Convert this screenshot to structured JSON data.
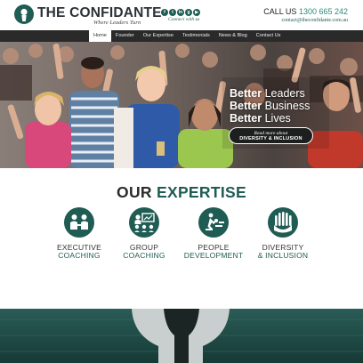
{
  "header": {
    "brand": "THE CONFIDANTE",
    "tagline": "Where Leaders Turn",
    "social_icons": [
      "facebook-icon",
      "twitter-icon",
      "linkedin-icon",
      "google-plus-icon",
      "youtube-icon"
    ],
    "social_caption": "Connect with us",
    "call_label": "CALL US",
    "phone": "1300 665 242",
    "email": "contact@theconfidante.com.au"
  },
  "nav": {
    "items": [
      "Home",
      "Founder",
      "Our Expertise",
      "Testimonials",
      "News & Blog",
      "Contact Us"
    ],
    "active": "Home"
  },
  "hero": {
    "lines": [
      {
        "bold": "Better",
        "rest": "Leaders"
      },
      {
        "bold": "Better",
        "rest": "Business"
      },
      {
        "bold": "Better",
        "rest": "Lives"
      }
    ],
    "button_line1": "Read more about",
    "button_line2": "DIVERSITY & INCLUSION"
  },
  "expertise": {
    "title_part1": "OUR",
    "title_part2": "EXPERTISE",
    "items": [
      {
        "line1": "EXECUTIVE",
        "line2": "COACHING",
        "icon": "executive-coaching-icon"
      },
      {
        "line1": "GROUP",
        "line2": "COACHING",
        "icon": "group-coaching-icon"
      },
      {
        "line1": "PEOPLE",
        "line2": "DEVELOPMENT",
        "icon": "people-development-icon"
      },
      {
        "line1": "DIVERSITY",
        "line2": "& INCLUSION",
        "icon": "diversity-inclusion-icon"
      }
    ]
  },
  "colors": {
    "brand_teal": "#1f5c54",
    "accent_teal": "#2c8a7d",
    "nav_bg": "#2a2a2a",
    "hero_button_bg": "#1d1f1f",
    "band_bg": "#1f4a45"
  }
}
